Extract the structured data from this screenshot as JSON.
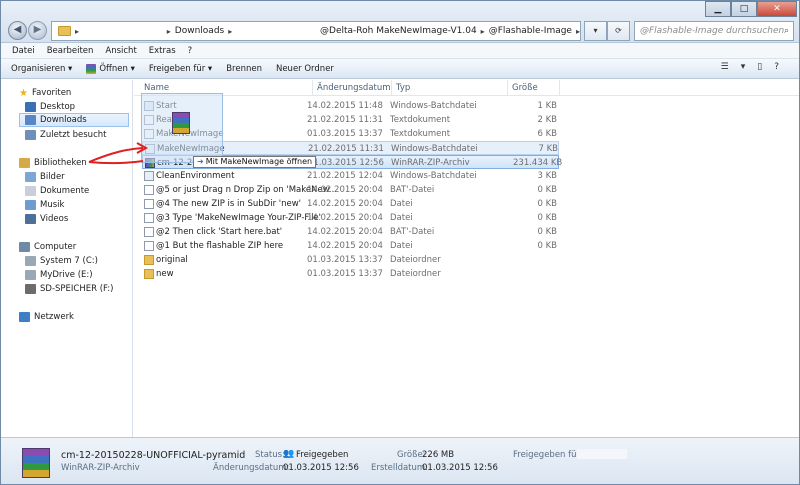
{
  "address": {
    "crumbs": [
      "Downloads",
      "@Delta-Roh MakeNewImage-V1.04",
      "@Flashable-Image"
    ],
    "search_placeholder": "@Flashable-Image durchsuchen"
  },
  "menu": [
    "Datei",
    "Bearbeiten",
    "Ansicht",
    "Extras",
    "?"
  ],
  "toolbar": {
    "organize": "Organisieren ▾",
    "open": "Öffnen ▾",
    "share": "Freigeben für ▾",
    "burn": "Brennen",
    "new_folder": "Neuer Ordner"
  },
  "nav": {
    "favorites": "Favoriten",
    "desktop": "Desktop",
    "downloads": "Downloads",
    "recent": "Zuletzt besucht",
    "libraries": "Bibliotheken",
    "pictures": "Bilder",
    "documents": "Dokumente",
    "music": "Musik",
    "videos": "Videos",
    "computer": "Computer",
    "drive_c": "System 7 (C:)",
    "drive_e": "MyDrive (E:)",
    "drive_f": "SD-SPEICHER (F:)",
    "network": "Netzwerk"
  },
  "columns": {
    "name": "Name",
    "date": "Änderungsdatum",
    "type": "Typ",
    "size": "Größe"
  },
  "files": [
    {
      "name": "Start",
      "date": "14.02.2015 11:48",
      "type": "Windows-Batchdatei",
      "size": "1 KB",
      "kind": "bat"
    },
    {
      "name": "Read",
      "date": "21.02.2015 11:31",
      "type": "Textdokument",
      "size": "2 KB",
      "kind": "txt"
    },
    {
      "name": "MakeNewImage",
      "date": "01.03.2015 13:37",
      "type": "Textdokument",
      "size": "6 KB",
      "kind": "txt"
    },
    {
      "name": "MakeNewImage",
      "date": "21.02.2015 11:31",
      "type": "Windows-Batchdatei",
      "size": "7 KB",
      "kind": "bat"
    },
    {
      "name": "cm-12-201",
      "date": "01.03.2015 12:56",
      "type": "WinRAR-ZIP-Archiv",
      "size": "231.434 KB",
      "kind": "zip"
    },
    {
      "name": "CleanEnvironment",
      "date": "21.02.2015 12:04",
      "type": "Windows-Batchdatei",
      "size": "3 KB",
      "kind": "bat"
    },
    {
      "name": "@5 or just Drag n Drop Zip on 'MakeNew...",
      "date": "14.02.2015 20:04",
      "type": "BAT'-Datei",
      "size": "0 KB",
      "kind": "txt"
    },
    {
      "name": "@4 The new ZIP is in SubDir 'new'",
      "date": "14.02.2015 20:04",
      "type": "Datei",
      "size": "0 KB",
      "kind": "txt"
    },
    {
      "name": "@3 Type 'MakeNewImage Your-ZIP-File'",
      "date": "14.02.2015 20:04",
      "type": "Datei",
      "size": "0 KB",
      "kind": "txt"
    },
    {
      "name": "@2 Then click 'Start here.bat'",
      "date": "14.02.2015 20:04",
      "type": "BAT'-Datei",
      "size": "0 KB",
      "kind": "txt"
    },
    {
      "name": "@1 But the flashable ZIP here",
      "date": "14.02.2015 20:04",
      "type": "Datei",
      "size": "0 KB",
      "kind": "txt"
    },
    {
      "name": "original",
      "date": "01.03.2015 13:37",
      "type": "Dateiordner",
      "size": "",
      "kind": "dir"
    },
    {
      "name": "new",
      "date": "01.03.2015 13:37",
      "type": "Dateiordner",
      "size": "",
      "kind": "dir"
    }
  ],
  "drag_tooltip": "Mit MakeNewImage öffnen",
  "details": {
    "filename": "cm-12-20150228-UNOFFICIAL-pyramid",
    "filetype": "WinRAR-ZIP-Archiv",
    "status_label": "Status:",
    "status_value": "Freigegeben",
    "modified_label": "Änderungsdatum:",
    "modified_value": "01.03.2015 12:56",
    "size_label": "Größe:",
    "size_value": "226 MB",
    "created_label": "Erstelldatum:",
    "created_value": "01.03.2015 12:56",
    "shared_label": "Freigegeben für:"
  },
  "colors": {
    "annotation_arrow": "#e02020",
    "selection": "#cfe3f8",
    "folder": "#e8c05a"
  }
}
